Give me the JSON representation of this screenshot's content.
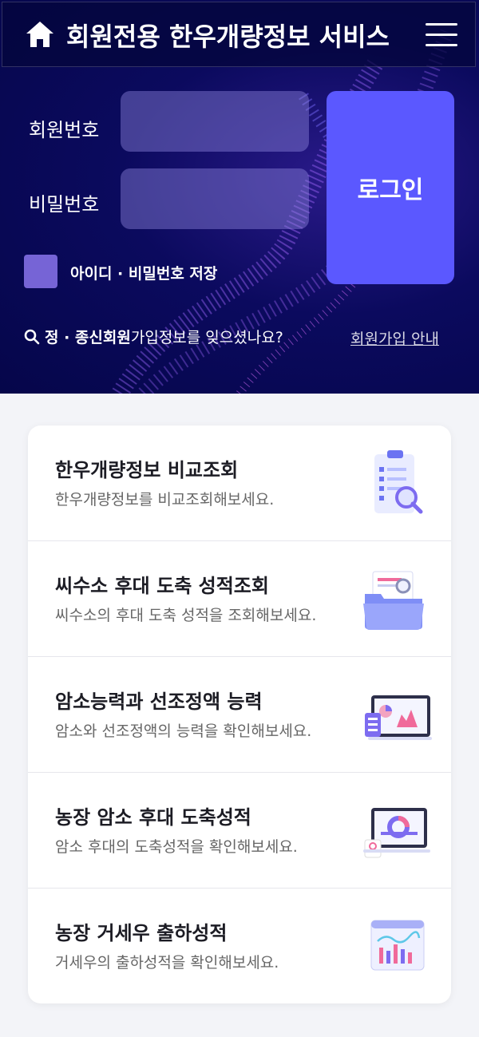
{
  "header": {
    "title": "회원전용 한우개량정보 서비스"
  },
  "login": {
    "member_no_label": "회원번호",
    "password_label": "비밀번호",
    "member_no_value": "",
    "password_value": "",
    "login_button": "로그인",
    "save_label": "아이디 · 비밀번호 저장",
    "find_bold": "정 · 종신회원",
    "find_text": " 가입정보를 잊으셨나요?",
    "join_link": "회원가입 안내"
  },
  "menu": [
    {
      "title": "한우개량정보 비교조회",
      "desc": "한우개량정보를 비교조회해보세요.",
      "icon": "clipboard-search-icon"
    },
    {
      "title": "씨수소 후대 도축 성적조회",
      "desc": "씨수소의 후대 도축 성적을 조회해보세요.",
      "icon": "folder-search-icon"
    },
    {
      "title": "암소능력과 선조정액 능력",
      "desc": "암소와 선조정액의 능력을 확인해보세요.",
      "icon": "laptop-chart-icon"
    },
    {
      "title": "농장 암소 후대 도축성적",
      "desc": "암소 후대의 도축성적을 확인해보세요.",
      "icon": "monitor-donut-icon"
    },
    {
      "title": "농장 거세우 출하성적",
      "desc": "거세우의 출하성적을 확인해보세요.",
      "icon": "bar-chart-window-icon"
    }
  ],
  "colors": {
    "accent": "#5b58ff",
    "hero_bg": "#0b0a5e"
  }
}
